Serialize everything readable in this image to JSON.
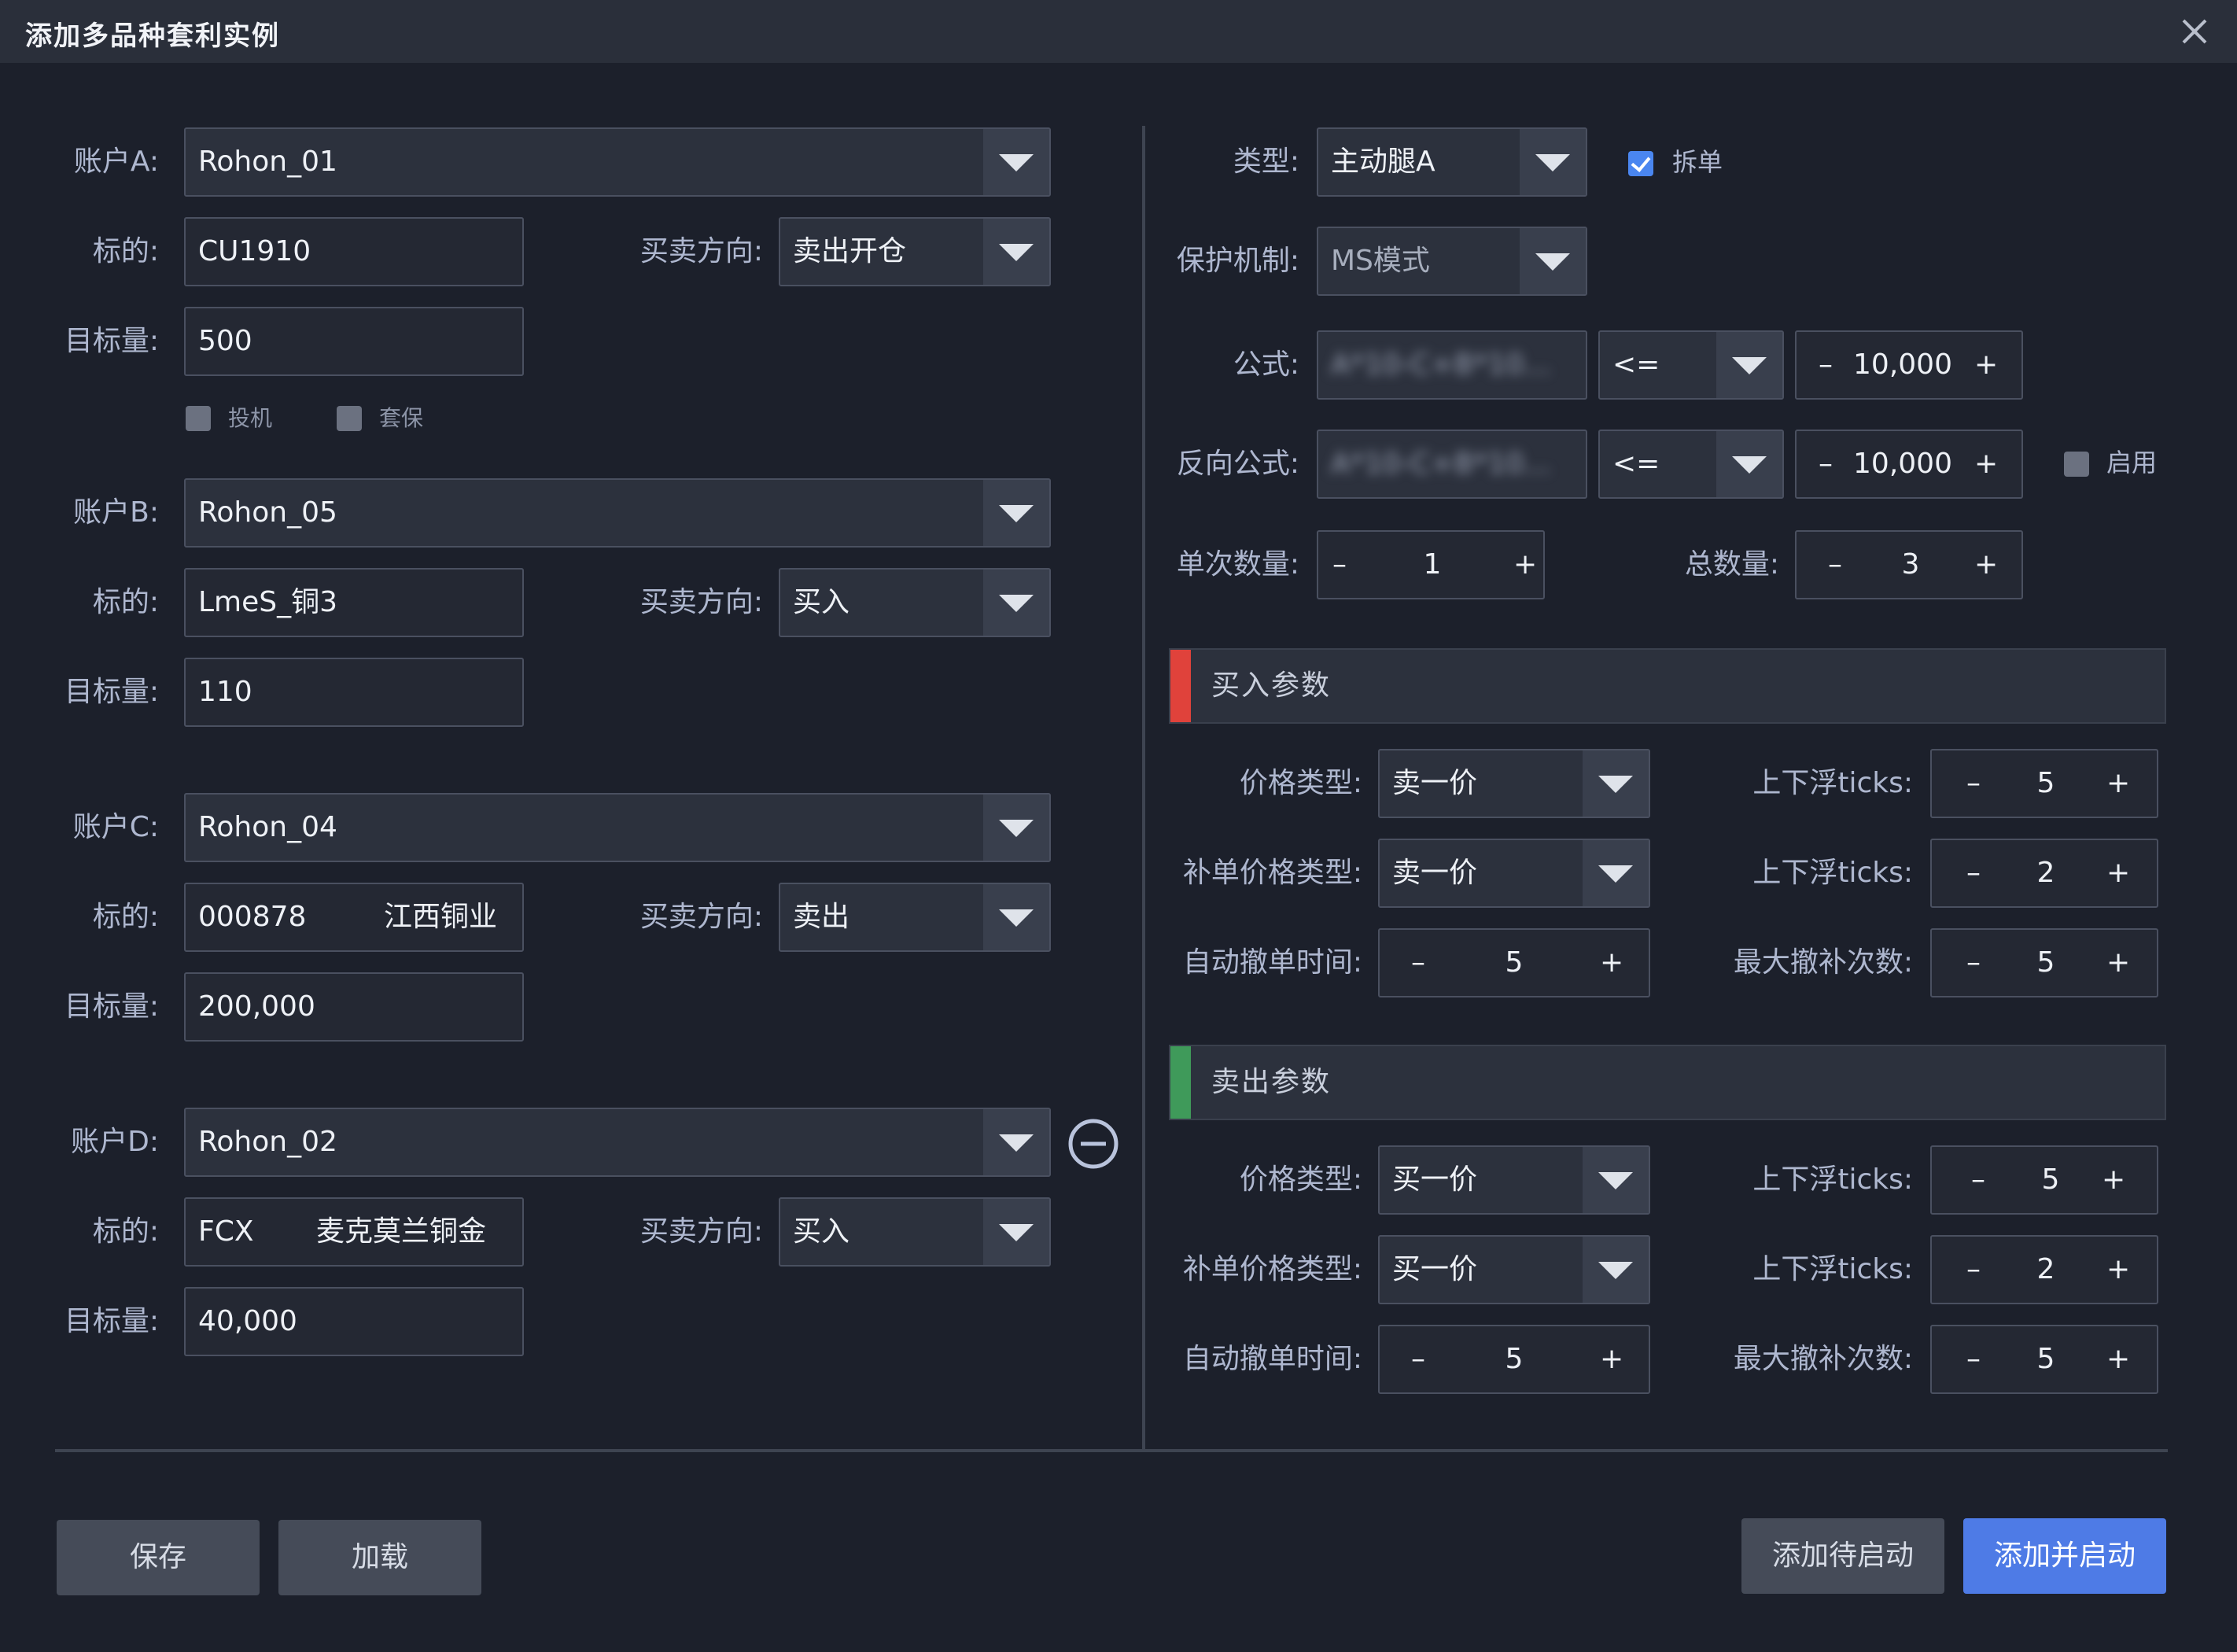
{
  "dialog": {
    "title": "添加多品种套利实例"
  },
  "left": {
    "account_label_a": "账户A:",
    "account_label_b": "账户B:",
    "account_label_c": "账户C:",
    "account_label_d": "账户D:",
    "symbol_label": "标的:",
    "direction_label": "买卖方向:",
    "target_label": "目标量:",
    "accounts": [
      {
        "account": "Rohon_01",
        "symbol_code": "CU1910",
        "symbol_name": "",
        "direction": "卖出开仓",
        "target": "500"
      },
      {
        "account": "Rohon_05",
        "symbol_code": "LmeS_铜3",
        "symbol_name": "",
        "direction": "买入",
        "target": "110"
      },
      {
        "account": "Rohon_04",
        "symbol_code": "000878",
        "symbol_name": "江西铜业",
        "direction": "卖出",
        "target": "200,000"
      },
      {
        "account": "Rohon_02",
        "symbol_code": "FCX",
        "symbol_name": "麦克莫兰铜金",
        "direction": "买入",
        "target": "40,000"
      }
    ],
    "checkboxes": {
      "speculation": "投机",
      "hedge": "套保"
    }
  },
  "right": {
    "type_label": "类型:",
    "type_value": "主动腿A",
    "split_label": "拆单",
    "protect_label": "保护机制:",
    "protect_value": "MS模式",
    "formula_label": "公式:",
    "formula_value": "A*10-C+B*10...",
    "formula_op": "<=",
    "formula_threshold": "10,000",
    "reverse_formula_label": "反向公式:",
    "reverse_formula_value": "A*10-C+B*10...",
    "reverse_op": "<=",
    "reverse_threshold": "10,000",
    "enable_label": "启用",
    "single_qty_label": "单次数量:",
    "single_qty": "1",
    "total_qty_label": "总数量:",
    "total_qty": "3",
    "buy_section": {
      "title": "买入参数",
      "price_type_label": "价格类型:",
      "price_type": "卖一价",
      "refill_price_type_label": "补单价格类型:",
      "refill_price_type": "卖一价",
      "auto_cancel_label": "自动撤单时间:",
      "auto_cancel": "5",
      "ticks_label": "上下浮ticks:",
      "ticks": "5",
      "refill_ticks_label": "上下浮ticks:",
      "refill_ticks": "2",
      "max_cancel_label": "最大撤补次数:",
      "max_cancel": "5"
    },
    "sell_section": {
      "title": "卖出参数",
      "price_type_label": "价格类型:",
      "price_type": "买一价",
      "refill_price_type_label": "补单价格类型:",
      "refill_price_type": "买一价",
      "auto_cancel_label": "自动撤单时间:",
      "auto_cancel": "5",
      "ticks_label": "上下浮ticks:",
      "ticks": "5",
      "refill_ticks_label": "上下浮ticks:",
      "refill_ticks": "2",
      "max_cancel_label": "最大撤补次数:",
      "max_cancel": "5"
    }
  },
  "stepper": {
    "minus": "–",
    "plus": "+"
  },
  "footer": {
    "save": "保存",
    "load": "加载",
    "add_pending": "添加待启动",
    "add_start": "添加并启动"
  },
  "colors": {
    "buy_stripe": "#e0423b",
    "sell_stripe": "#3f9a5a",
    "primary": "#4e7be6"
  },
  "icons": {
    "close": "close-icon",
    "remove": "minus-circle-icon",
    "dropdown": "triangle-down-icon",
    "checkbox": "checkbox-icon"
  }
}
